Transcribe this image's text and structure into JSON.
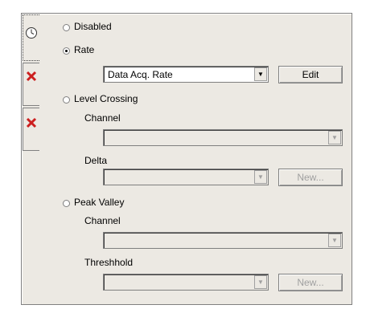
{
  "tabs": [
    {
      "icon": "clock-icon",
      "state": "selected"
    },
    {
      "icon": "red-x-icon",
      "state": "error"
    },
    {
      "icon": "red-x-icon",
      "state": "error"
    }
  ],
  "options": {
    "disabled": {
      "label": "Disabled",
      "selected": false
    },
    "rate": {
      "label": "Rate",
      "selected": true,
      "combo_value": "Data Acq. Rate",
      "edit_label": "Edit"
    },
    "level_crossing": {
      "label": "Level Crossing",
      "selected": false,
      "channel_label": "Channel",
      "channel_value": "",
      "delta_label": "Delta",
      "delta_value": "",
      "new_label": "New..."
    },
    "peak_valley": {
      "label": "Peak Valley",
      "selected": false,
      "channel_label": "Channel",
      "channel_value": "",
      "threshold_label": "Threshhold",
      "threshold_value": "",
      "new_label": "New..."
    }
  },
  "colors": {
    "panel": "#ece9e3",
    "error_x": "#cc1f1f",
    "disabled_text": "#a0a0a0"
  }
}
